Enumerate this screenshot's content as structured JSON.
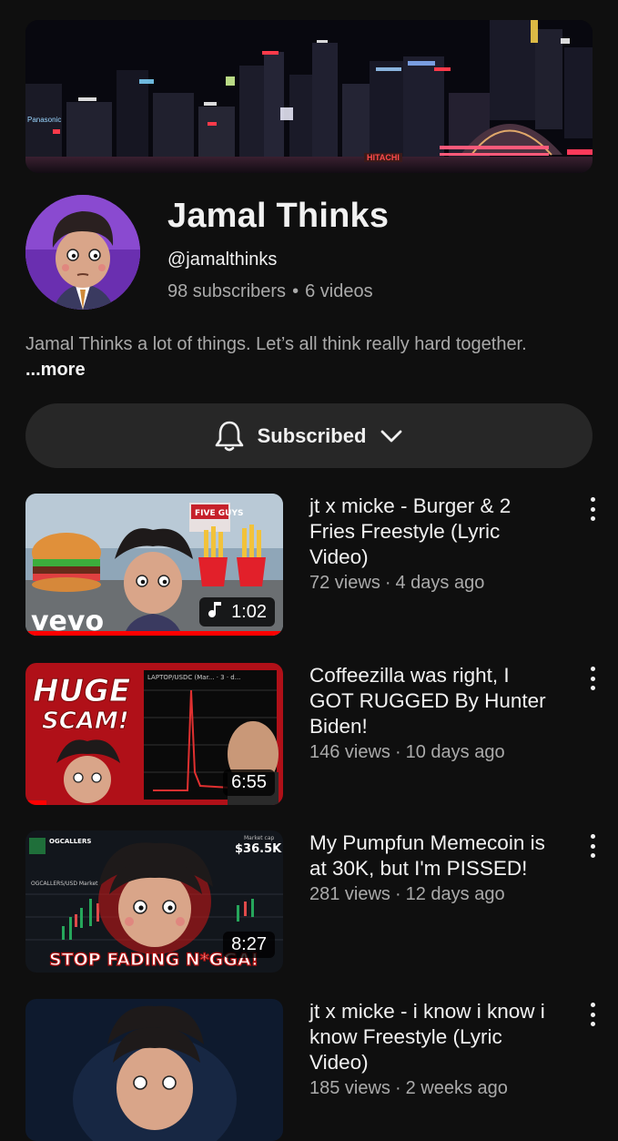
{
  "channel": {
    "name": "Jamal Thinks",
    "handle": "@jamalthinks",
    "subscribers": "98 subscribers",
    "videos": "6 videos",
    "separator": "•",
    "description": "Jamal Thinks a lot of things. Let’s all think really hard together.",
    "more_label": "...more"
  },
  "banner_signs": {
    "hitachi": "HITACHI",
    "panasonic": "Panasonic"
  },
  "subscribe": {
    "label": "Subscribed",
    "bell_icon": "bell-icon",
    "chevron_icon": "chevron-down-icon"
  },
  "videos": [
    {
      "title": "jt x micke - Burger & 2 Fries Freestyle (Lyric Video)",
      "views": "72 views",
      "age": "4 days ago",
      "sep": "·",
      "duration": "1:02",
      "music_icon": "music-note-icon",
      "thumb_text": {
        "vevo": "vevo",
        "sign": "FIVE GUYS"
      },
      "progress": 1.0
    },
    {
      "title": "Coffeezilla was right, I GOT RUGGED By Hunter Biden!",
      "views": "146 views",
      "age": "10 days ago",
      "sep": "·",
      "duration": "6:55",
      "thumb_text": {
        "huge": "HUGE",
        "scam": "SCAM!",
        "chart_label": "LAPTOP/USDC (Mar... · 3 · d..."
      },
      "progress": 0.08
    },
    {
      "title": "My Pumpfun Memecoin is at 30K, but I'm PISSED!",
      "views": "281 views",
      "age": "12 days ago",
      "sep": "·",
      "duration": "8:27",
      "thumb_text": {
        "brand": "OGCALLERS",
        "pair": "OGCALLERS/USD Market",
        "mcap_label": "Market cap",
        "mcap": "$36.5K",
        "banner": "STOP FADING N*GGA!"
      }
    },
    {
      "title": "jt x micke - i know i know i know Freestyle (Lyric Video)",
      "views": "185 views",
      "age": "2 weeks ago",
      "sep": "·"
    }
  ],
  "colors": {
    "background": "#0f0f0f",
    "text": "#f1f1f1",
    "secondary": "#aaaaaa",
    "button": "#272727",
    "progress": "#ff0000"
  }
}
